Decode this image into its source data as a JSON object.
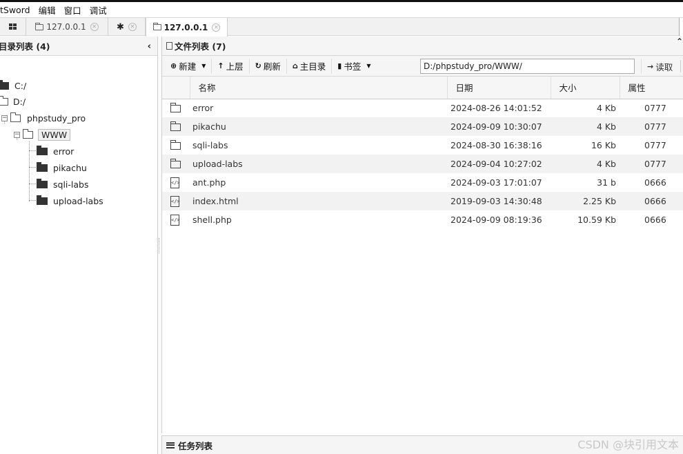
{
  "menubar": {
    "items": [
      "tSword",
      "编辑",
      "窗口",
      "调试"
    ]
  },
  "tabs": [
    {
      "label": "",
      "icon": "grid-icon"
    },
    {
      "label": "127.0.0.1",
      "icon": "folder-icon",
      "closable": true
    },
    {
      "label": "",
      "icon": "gear-icon",
      "closable": true
    },
    {
      "label": "127.0.0.1",
      "icon": "folder-icon",
      "closable": true,
      "active": true
    }
  ],
  "left_panel": {
    "title": "目录列表 (4)",
    "tree": {
      "c_drive": "C:/",
      "d_drive": "D:/",
      "phpstudy": "phpstudy_pro",
      "www": "WWW",
      "children": [
        "error",
        "pikachu",
        "sqli-labs",
        "upload-labs"
      ]
    }
  },
  "right_panel": {
    "title": "文件列表 (7)",
    "toolbar": {
      "new": "新建",
      "up": "上层",
      "refresh": "刷新",
      "home": "主目录",
      "bookmark": "书签",
      "path": "D:/phpstudy_pro/WWW/",
      "read": "读取"
    },
    "columns": {
      "name": "名称",
      "date": "日期",
      "size": "大小",
      "attr": "属性"
    },
    "files": [
      {
        "type": "folder",
        "name": "error",
        "date": "2024-08-26 14:01:52",
        "size": "4 Kb",
        "attr": "0777"
      },
      {
        "type": "folder",
        "name": "pikachu",
        "date": "2024-09-09 10:30:07",
        "size": "4 Kb",
        "attr": "0777"
      },
      {
        "type": "folder",
        "name": "sqli-labs",
        "date": "2024-08-30 16:38:16",
        "size": "16 Kb",
        "attr": "0777"
      },
      {
        "type": "folder",
        "name": "upload-labs",
        "date": "2024-09-04 10:27:02",
        "size": "4 Kb",
        "attr": "0777"
      },
      {
        "type": "file",
        "name": "ant.php",
        "date": "2024-09-03 17:01:07",
        "size": "31 b",
        "attr": "0666"
      },
      {
        "type": "file",
        "name": "index.html",
        "date": "2019-09-03 14:30:48",
        "size": "2.25 Kb",
        "attr": "0666"
      },
      {
        "type": "file",
        "name": "shell.php",
        "date": "2024-09-09 08:19:36",
        "size": "10.59 Kb",
        "attr": "0666"
      }
    ]
  },
  "task_panel": {
    "title": "任务列表"
  },
  "watermark": "CSDN @块引用文本"
}
